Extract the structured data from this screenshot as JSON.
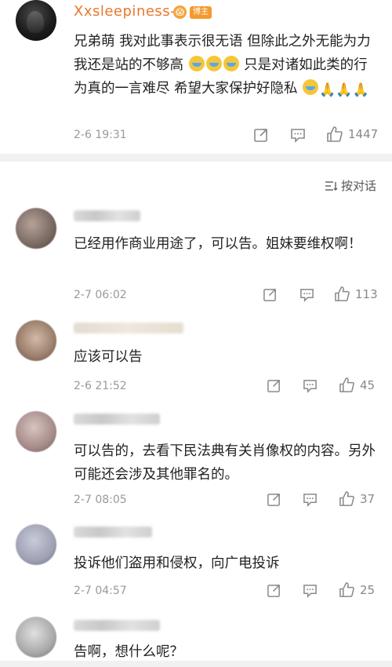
{
  "post": {
    "username": "Xxsleepiness-",
    "badge_icon": "😱",
    "role_badge": "博主",
    "text_1": "兄弟萌 我对此事表示很无语 但除此之外无能为力 我还是站的不够高",
    "text_2": "只是对诸如此类的行为真的一言难尽 希望大家保护好隐私",
    "emoji_cry": "crying-face-icon",
    "pray": "🙏🙏🙏",
    "time": "2-6 19:31",
    "likes": "1447"
  },
  "sort_label": "按对话",
  "comments": [
    {
      "text": "已经用作商业用途了，可以告。姐妹要维权啊！",
      "time": "2-7 06:02",
      "likes": "113"
    },
    {
      "text": "应该可以告",
      "time": "2-6 21:52",
      "likes": "45"
    },
    {
      "text": "可以告的，去看下民法典有关肖像权的内容。另外可能还会涉及其他罪名的。",
      "time": "2-7 08:05",
      "likes": "37"
    },
    {
      "text": "投诉他们盗用和侵权，向广电投诉",
      "time": "2-7 04:57",
      "likes": "25"
    },
    {
      "text": "告啊，想什么呢？",
      "time": "",
      "likes": ""
    }
  ],
  "icons": {
    "repost": "repost-icon",
    "comment": "comment-icon",
    "like": "thumbs-up-icon",
    "sort": "sort-icon"
  }
}
